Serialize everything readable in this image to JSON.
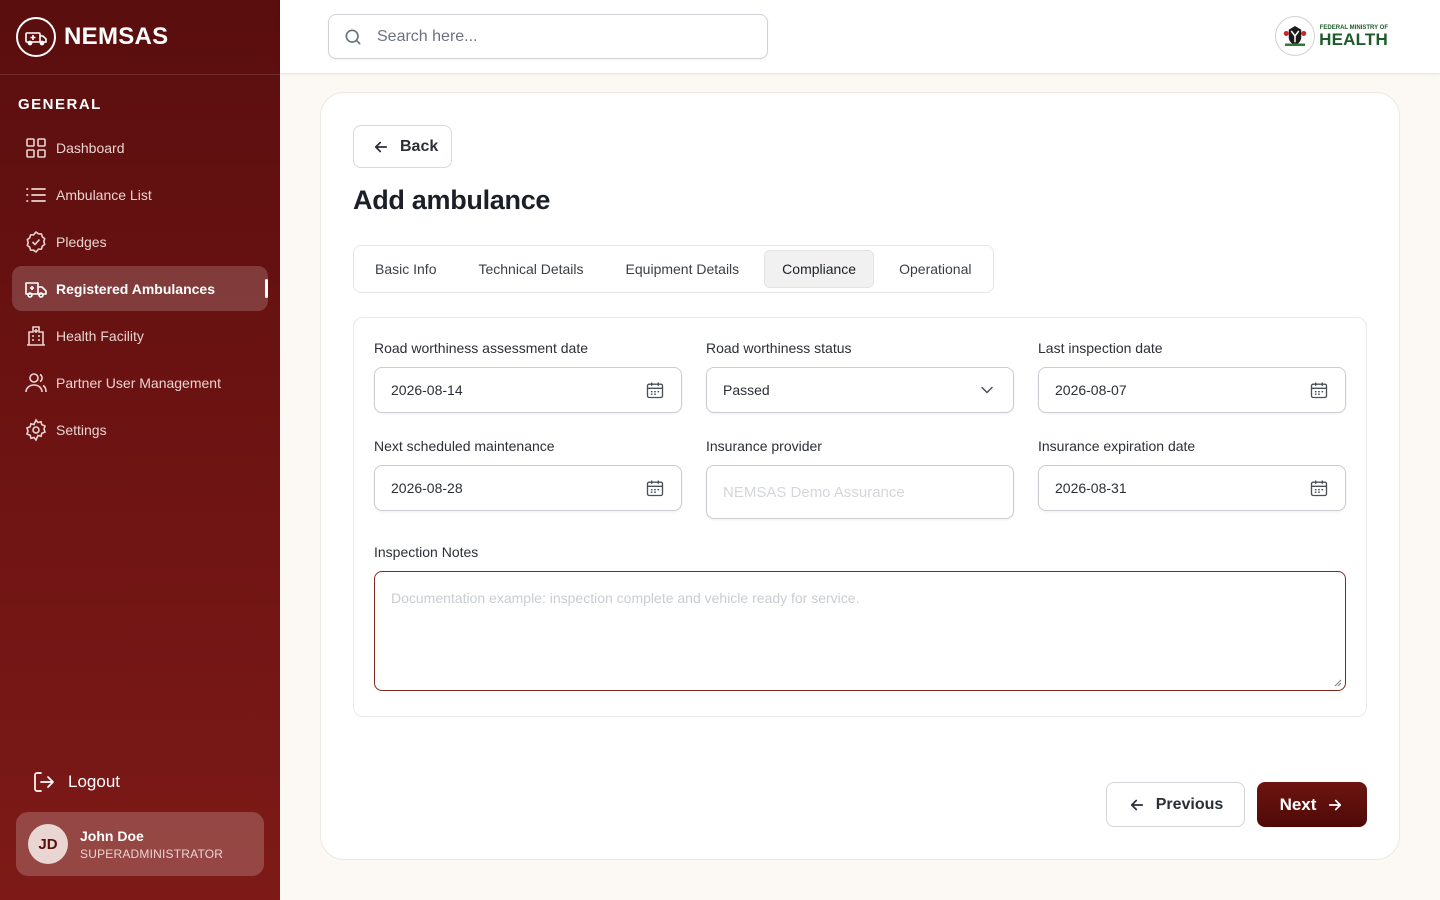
{
  "brand": {
    "name": "NEMSAS"
  },
  "sidebar": {
    "section_label": "GENERAL",
    "items": [
      {
        "label": "Dashboard",
        "icon": "dashboard-icon"
      },
      {
        "label": "Ambulance List",
        "icon": "list-icon"
      },
      {
        "label": "Pledges",
        "icon": "badge-check-icon"
      },
      {
        "label": "Registered Ambulances",
        "icon": "ambulance-icon",
        "active": true
      },
      {
        "label": "Health Facility",
        "icon": "building-icon"
      },
      {
        "label": "Partner User Management",
        "icon": "users-icon"
      },
      {
        "label": "Settings",
        "icon": "gear-icon"
      }
    ],
    "logout_label": "Logout"
  },
  "user": {
    "initials": "JD",
    "name": "John Doe",
    "role": "SUPERADMINISTRATOR"
  },
  "search": {
    "placeholder": "Search here..."
  },
  "ministry": {
    "small": "FEDERAL MINISTRY OF",
    "big": "HEALTH",
    "color": "#1d5b2a"
  },
  "page": {
    "back_label": "Back",
    "title": "Add ambulance",
    "tabs": [
      {
        "label": "Basic Info"
      },
      {
        "label": "Technical Details"
      },
      {
        "label": "Equipment Details"
      },
      {
        "label": "Compliance",
        "active": true
      },
      {
        "label": "Operational"
      }
    ]
  },
  "form": {
    "road_assessment": {
      "label": "Road worthiness assessment date",
      "value": "2026-08-14"
    },
    "road_status": {
      "label": "Road worthiness status",
      "value": "Passed"
    },
    "last_inspection": {
      "label": "Last inspection date",
      "value": "2026-08-07"
    },
    "next_maintenance": {
      "label": "Next scheduled maintenance",
      "value": "2026-08-28"
    },
    "insurance_provider": {
      "label": "Insurance provider",
      "placeholder": "NEMSAS Demo Assurance"
    },
    "insurance_expiration": {
      "label": "Insurance expiration date",
      "value": "2026-08-31"
    },
    "inspection_notes": {
      "label": "Inspection Notes",
      "placeholder": "Documentation example: inspection complete and vehicle ready for service."
    }
  },
  "actions": {
    "previous_label": "Previous",
    "next_label": "Next"
  },
  "colors": {
    "brand_dark": "#5a0e0e",
    "accent": "#7d2a22"
  }
}
